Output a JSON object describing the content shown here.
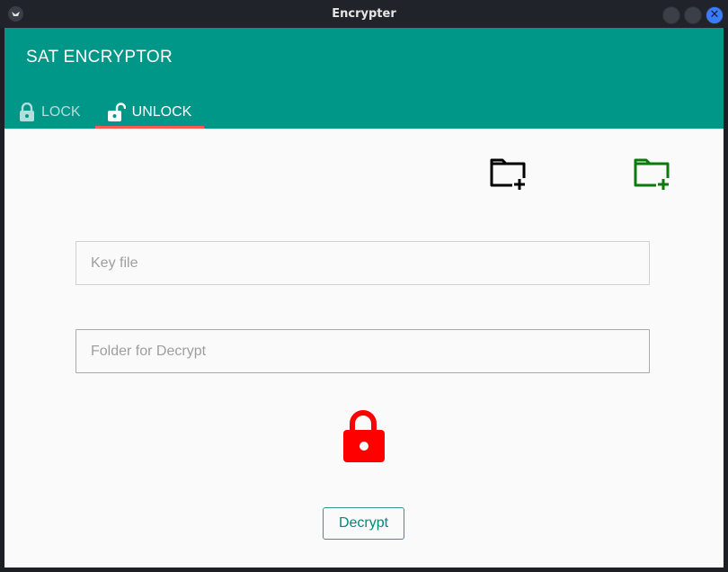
{
  "window": {
    "title": "Encrypter"
  },
  "header": {
    "app_title": "SAT ENCRYPTOR"
  },
  "tabs": [
    {
      "label": "LOCK",
      "selected": false
    },
    {
      "label": "UNLOCK",
      "selected": true
    }
  ],
  "toolbar": {
    "icons": [
      "folder-add-icon",
      "folder-add-icon"
    ],
    "colors": {
      "first": "#000000",
      "second": "#0a7a0a"
    }
  },
  "form": {
    "key_file": {
      "placeholder": "Key file",
      "value": ""
    },
    "folder": {
      "placeholder": "Folder for Decrypt",
      "value": ""
    }
  },
  "status": {
    "icon": "lock-closed-icon",
    "color": "#ff0000"
  },
  "actions": {
    "decrypt_label": "Decrypt"
  },
  "colors": {
    "accent": "#009688",
    "tab_indicator": "#ff5a4e"
  }
}
